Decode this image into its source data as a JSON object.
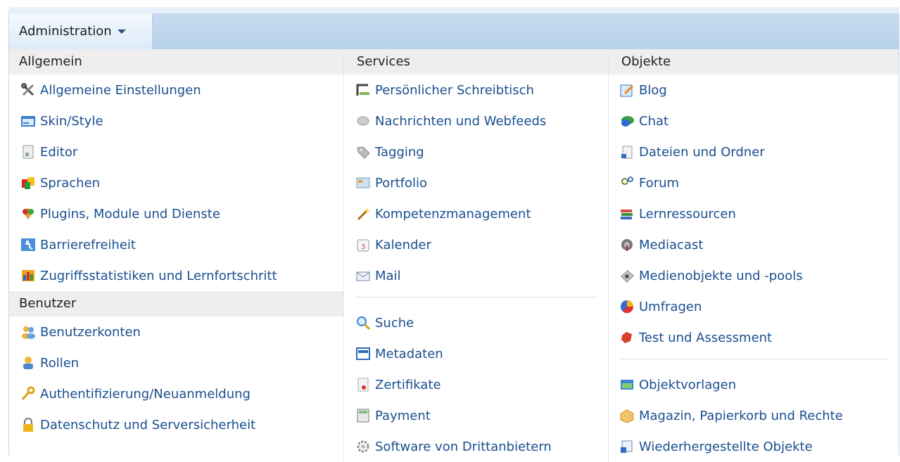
{
  "menu": {
    "label": "Administration"
  },
  "col1": {
    "head1": "Allgemein",
    "items1": [
      {
        "label": "Allgemeine Einstellungen",
        "icon": "tools-icon"
      },
      {
        "label": "Skin/Style",
        "icon": "window-icon"
      },
      {
        "label": "Editor",
        "icon": "editor-icon"
      },
      {
        "label": "Sprachen",
        "icon": "languages-icon"
      },
      {
        "label": "Plugins, Module und Dienste",
        "icon": "puzzle-icon"
      },
      {
        "label": "Barrierefreiheit",
        "icon": "accessibility-icon"
      },
      {
        "label": "Zugriffsstatistiken und Lernfortschritt",
        "icon": "statistics-icon"
      }
    ],
    "head2": "Benutzer",
    "items2": [
      {
        "label": "Benutzerkonten",
        "icon": "users-icon"
      },
      {
        "label": "Rollen",
        "icon": "role-icon"
      },
      {
        "label": "Authentifizierung/Neuanmeldung",
        "icon": "key-icon"
      },
      {
        "label": "Datenschutz und Serversicherheit",
        "icon": "lock-icon"
      }
    ]
  },
  "col2": {
    "head": "Services",
    "items1": [
      {
        "label": "Persönlicher Schreibtisch",
        "icon": "desk-icon"
      },
      {
        "label": "Nachrichten und Webfeeds",
        "icon": "news-icon"
      },
      {
        "label": "Tagging",
        "icon": "tag-icon"
      },
      {
        "label": "Portfolio",
        "icon": "portfolio-icon"
      },
      {
        "label": "Kompetenzmanagement",
        "icon": "wand-icon"
      },
      {
        "label": "Kalender",
        "icon": "calendar-icon"
      },
      {
        "label": "Mail",
        "icon": "mail-icon"
      }
    ],
    "items2": [
      {
        "label": "Suche",
        "icon": "search-icon"
      },
      {
        "label": "Metadaten",
        "icon": "metadata-icon"
      },
      {
        "label": "Zertifikate",
        "icon": "certificate-icon"
      },
      {
        "label": "Payment",
        "icon": "calculator-icon"
      },
      {
        "label": "Software von Drittanbietern",
        "icon": "gear-icon"
      }
    ]
  },
  "col3": {
    "head": "Objekte",
    "items1": [
      {
        "label": "Blog",
        "icon": "blog-icon"
      },
      {
        "label": "Chat",
        "icon": "chat-icon"
      },
      {
        "label": "Dateien und Ordner",
        "icon": "file-icon"
      },
      {
        "label": "Forum",
        "icon": "forum-icon"
      },
      {
        "label": "Lernressourcen",
        "icon": "books-icon"
      },
      {
        "label": "Mediacast",
        "icon": "mediacast-icon"
      },
      {
        "label": "Medienobjekte und -pools",
        "icon": "media-icon"
      },
      {
        "label": "Umfragen",
        "icon": "survey-icon"
      },
      {
        "label": "Test und Assessment",
        "icon": "test-icon"
      }
    ],
    "items2": [
      {
        "label": "Objektvorlagen",
        "icon": "template-icon"
      },
      {
        "label": "Magazin, Papierkorb und Rechte",
        "icon": "box-icon"
      },
      {
        "label": "Wiederhergestellte Objekte",
        "icon": "restore-icon"
      }
    ]
  },
  "colors": {
    "link": "#1a4f8f",
    "header_bg": "#eeeeee",
    "bar": "#b7d1ec"
  }
}
